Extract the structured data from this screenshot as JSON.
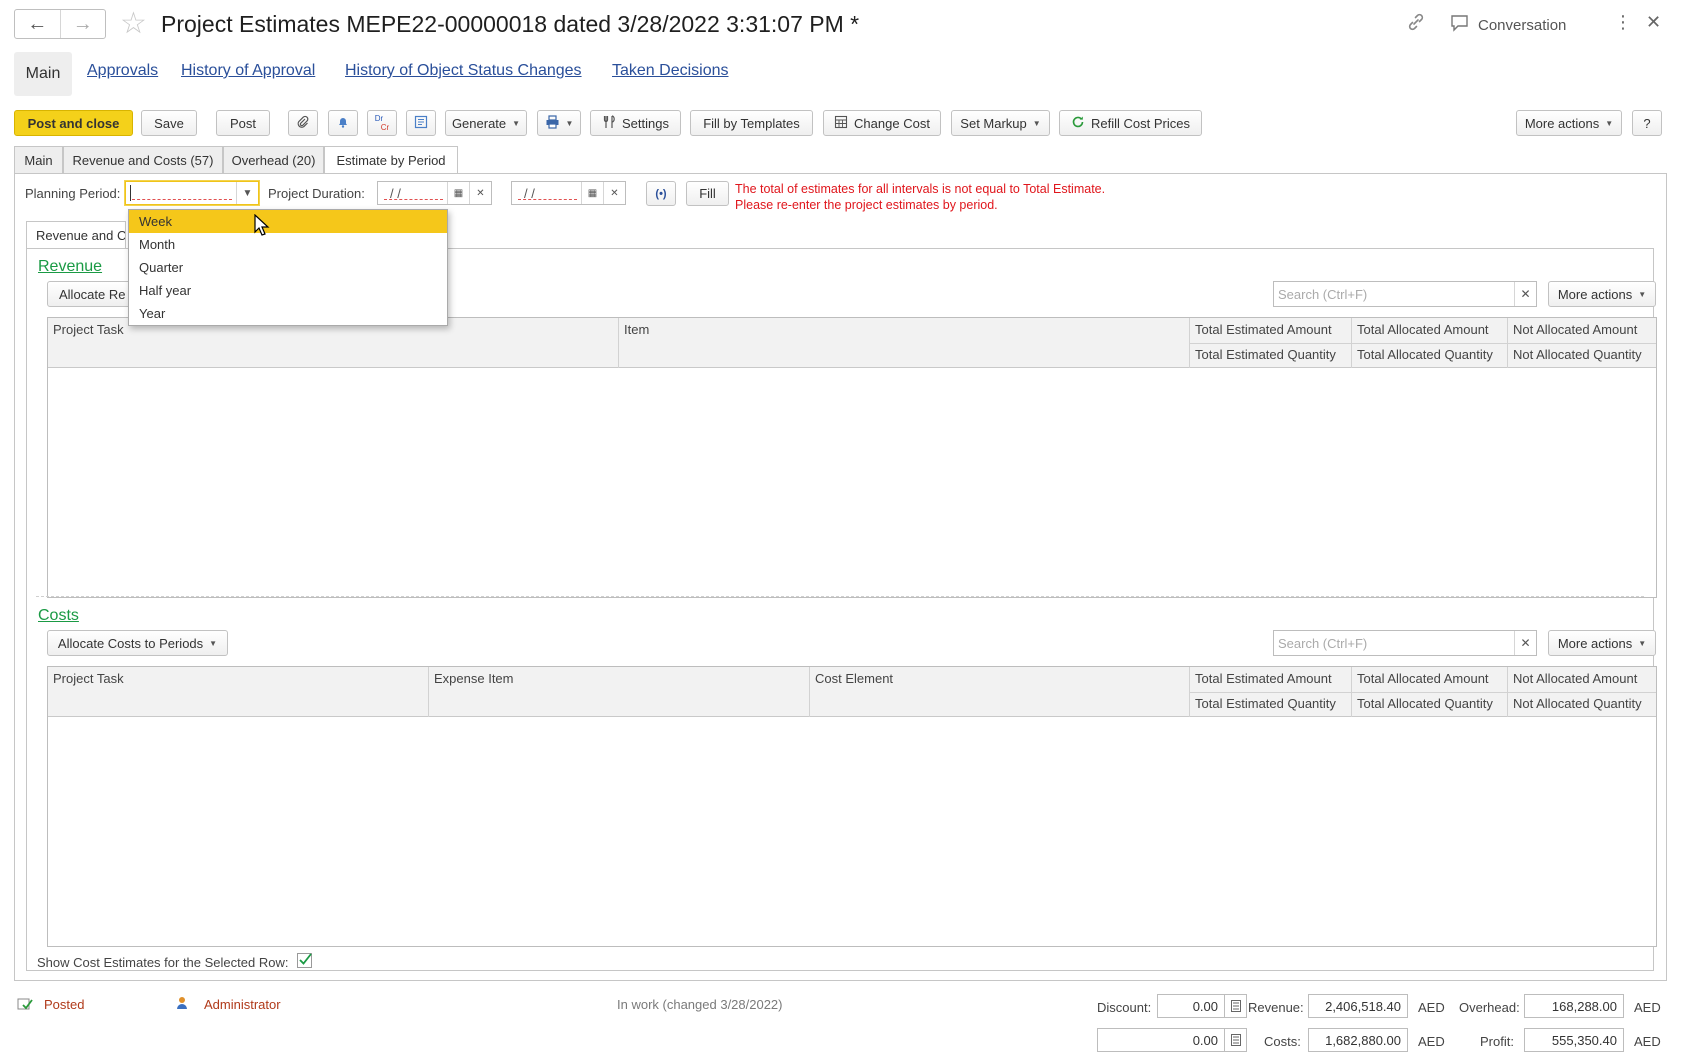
{
  "window": {
    "title": "Project Estimates MEPE22-00000018 dated 3/28/2022 3:31:07 PM *",
    "conversation_label": "Conversation"
  },
  "top_links": {
    "main": "Main",
    "items": [
      "Approvals",
      "History of Approval",
      "History of Object Status Changes",
      "Taken Decisions"
    ]
  },
  "toolbar": {
    "post_and_close": "Post and close",
    "save": "Save",
    "post": "Post",
    "dr": "Dr",
    "cr": "Cr",
    "generate": "Generate",
    "settings": "Settings",
    "fill_by_templates": "Fill by Templates",
    "change_cost": "Change Cost",
    "set_markup": "Set Markup",
    "refill_cost_prices": "Refill Cost Prices",
    "more_actions": "More actions",
    "help": "?"
  },
  "tabs": [
    "Main",
    "Revenue and Costs (57)",
    "Overhead (20)",
    "Estimate by Period"
  ],
  "planning": {
    "planning_period_label": "Planning Period:",
    "planning_period_value": "",
    "project_duration_label": "Project Duration:",
    "date_from": "/ /",
    "date_to": "/ /",
    "fill_button": "Fill",
    "error_line1": "The total of estimates for all intervals is not equal to Total Estimate.",
    "error_line2": "Please re-enter the project estimates by period."
  },
  "dropdown": {
    "options": [
      "Week",
      "Month",
      "Quarter",
      "Half year",
      "Year"
    ],
    "highlighted": "Week"
  },
  "inner_tab": "Revenue and Co",
  "revenue": {
    "title": "Revenue",
    "allocate_button": "Allocate Re",
    "search_placeholder": "Search (Ctrl+F)",
    "more_actions": "More actions",
    "columns": {
      "project_task": "Project Task",
      "item": "Item",
      "total_estimated_amount": "Total Estimated Amount",
      "total_allocated_amount": "Total Allocated Amount",
      "not_allocated_amount": "Not Allocated Amount",
      "total_estimated_quantity": "Total Estimated Quantity",
      "total_allocated_quantity": "Total Allocated Quantity",
      "not_allocated_quantity": "Not Allocated Quantity"
    },
    "rows": []
  },
  "costs": {
    "title": "Costs",
    "allocate_button": "Allocate Costs to Periods",
    "search_placeholder": "Search (Ctrl+F)",
    "more_actions": "More actions",
    "columns": {
      "project_task": "Project Task",
      "expense_item": "Expense Item",
      "cost_element": "Cost Element",
      "total_estimated_amount": "Total Estimated Amount",
      "total_allocated_amount": "Total Allocated Amount",
      "not_allocated_amount": "Not Allocated Amount",
      "total_estimated_quantity": "Total Estimated Quantity",
      "total_allocated_quantity": "Total Allocated Quantity",
      "not_allocated_quantity": "Not Allocated Quantity"
    },
    "rows": []
  },
  "show_cost_estimates": {
    "label": "Show Cost Estimates for the Selected Row:",
    "checked": true
  },
  "footer": {
    "status": "Posted",
    "user": "Administrator",
    "state": "In work (changed 3/28/2022)",
    "discount_label": "Discount:",
    "discount_value": "0.00",
    "discount_value2": "0.00",
    "revenue_label": "Revenue:",
    "revenue_value": "2,406,518.40",
    "costs_label": "Costs:",
    "costs_value": "1,682,880.00",
    "overhead_label": "Overhead:",
    "overhead_value": "168,288.00",
    "profit_label": "Profit:",
    "profit_value": "555,350.40",
    "currency": "AED"
  },
  "colors": {
    "primary_button": "#f4d11a",
    "link": "#2a4f9a",
    "group_title": "#1a9a44",
    "error": "#e0161c",
    "dropdown_highlight": "#f5c71a"
  }
}
